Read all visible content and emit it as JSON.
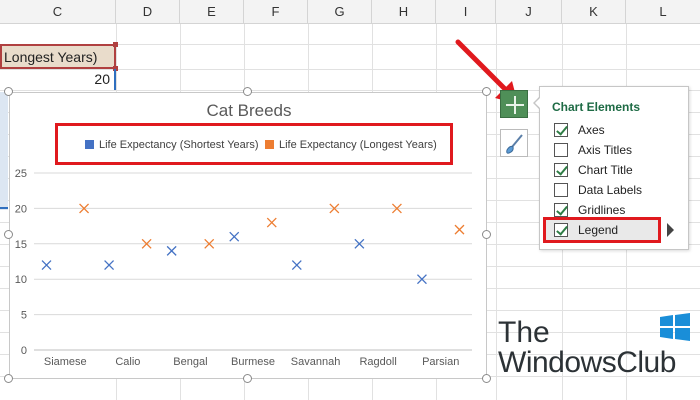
{
  "sheet": {
    "columns": [
      "C",
      "D",
      "E",
      "F",
      "G",
      "H",
      "I",
      "J",
      "K",
      "L"
    ],
    "header_cell_text": "Longest Years)",
    "value_cell_text": "20"
  },
  "chart_data": {
    "type": "scatter",
    "title": "Cat Breeds",
    "categories": [
      "Siamese",
      "Calio",
      "Bengal",
      "Burmese",
      "Savannah",
      "Ragdoll",
      "Parsian"
    ],
    "series": [
      {
        "name": "Life Expectancy (Shortest Years)",
        "values": [
          12,
          12,
          14,
          16,
          12,
          15,
          10
        ],
        "color": "#4472c4",
        "marker": "x"
      },
      {
        "name": "Life Expectancy (Longest Years)",
        "values": [
          20,
          15,
          15,
          18,
          20,
          20,
          17
        ],
        "color": "#ed7d31",
        "marker": "x"
      }
    ],
    "ylim": [
      0,
      25
    ],
    "yticks": [
      0,
      5,
      10,
      15,
      20,
      25
    ],
    "grid": true,
    "legend_position": "top"
  },
  "chart_elements_panel": {
    "title": "Chart Elements",
    "items": [
      {
        "label": "Axes",
        "checked": true
      },
      {
        "label": "Axis Titles",
        "checked": false
      },
      {
        "label": "Chart Title",
        "checked": true
      },
      {
        "label": "Data Labels",
        "checked": false
      },
      {
        "label": "Gridlines",
        "checked": true
      },
      {
        "label": "Legend",
        "checked": true
      }
    ]
  },
  "logo": {
    "line1": "The",
    "line2": "WindowsClub"
  },
  "colors": {
    "highlight_red": "#e0191e",
    "plus_button": "#4f8f58",
    "panel_title": "#1e6b45"
  }
}
